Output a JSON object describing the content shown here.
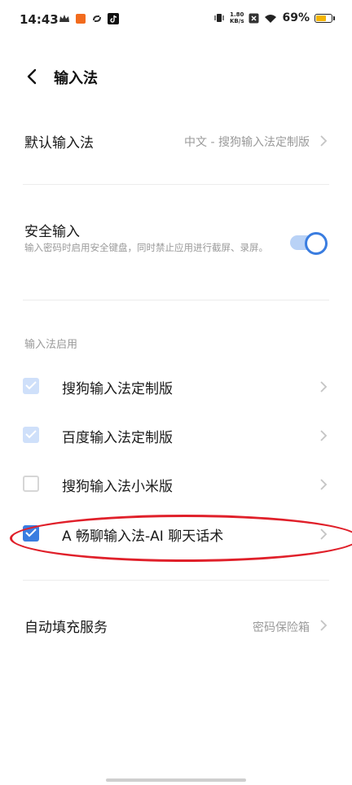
{
  "status_bar": {
    "time": "14:43",
    "net_speed_value": "1.80",
    "net_speed_unit": "KB/s",
    "battery_percent": "69%",
    "battery_level": 0.69,
    "battery_color": "#f4b400"
  },
  "header": {
    "title": "输入法"
  },
  "default_ime": {
    "label": "默认输入法",
    "value": "中文 - 搜狗输入法定制版"
  },
  "secure_input": {
    "label": "安全输入",
    "description": "输入密码时启用安全键盘，同时禁止应用进行截屏、录屏。",
    "enabled": true
  },
  "ime_section": {
    "label": "输入法启用",
    "items": [
      {
        "label": "搜狗输入法定制版",
        "state": "checked-disabled"
      },
      {
        "label": "百度输入法定制版",
        "state": "checked-disabled"
      },
      {
        "label": "搜狗输入法小米版",
        "state": "unchecked"
      },
      {
        "label": "A 畅聊输入法-AI 聊天话术",
        "state": "checked"
      }
    ]
  },
  "autofill": {
    "label": "自动填充服务",
    "value": "密码保险箱"
  },
  "colors": {
    "accent": "#3a7de0",
    "highlight": "#e0202a"
  }
}
